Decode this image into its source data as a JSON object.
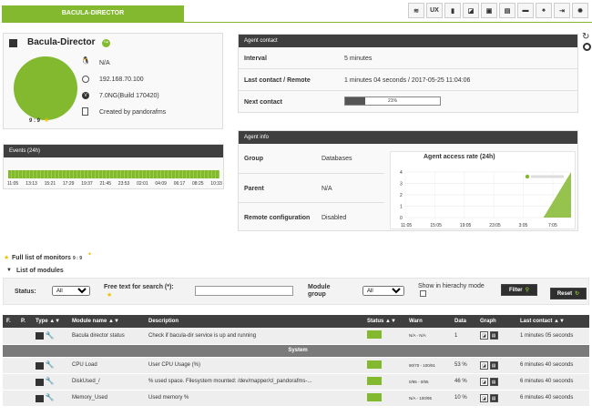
{
  "tab": {
    "label": "BACULA-DIRECTOR"
  },
  "toolbar": {
    "ux": "UX"
  },
  "agent": {
    "name": "Bacula-Director",
    "os": "N/A",
    "ip": "192.168.70.100",
    "version": "7.0NG(Build 170420)",
    "created_by": "Created by pandorafms",
    "count": "9 : 9"
  },
  "contact": {
    "title": "Agent contact",
    "rows": [
      {
        "label": "Interval",
        "value": "5 minutes"
      },
      {
        "label": "Last contact / Remote",
        "value": "1 minutes 04 seconds / 2017-05-25 11:04:06"
      },
      {
        "label": "Next contact",
        "progress": "21%",
        "progress_value": 0.21
      }
    ]
  },
  "events": {
    "title": "Events (24h)",
    "times": [
      "11:05",
      "13:13",
      "15:21",
      "17:29",
      "19:37",
      "21:45",
      "23:53",
      "02:01",
      "04:09",
      "06:17",
      "08:25",
      "10:33"
    ]
  },
  "info": {
    "title": "Agent info",
    "rows": [
      {
        "label": "Group",
        "value": "Databases"
      },
      {
        "label": "Parent",
        "value": "N/A"
      },
      {
        "label": "Remote configuration",
        "value": "Disabled"
      }
    ]
  },
  "chart_data": {
    "type": "area",
    "title": "Agent access rate (24h)",
    "x": [
      "11:05",
      "15:05",
      "19:05",
      "23:05",
      "3:05",
      "7:05"
    ],
    "y_ticks": [
      0,
      1,
      2,
      3,
      4
    ],
    "ylim": [
      0,
      4
    ],
    "series": [
      {
        "values": [
          0,
          0,
          0,
          0,
          0,
          0,
          4
        ]
      }
    ]
  },
  "monitors": {
    "full_list": "Full list of monitors",
    "count": "9 : 9",
    "list_of_modules": "List of modules",
    "status_label": "Status:",
    "status_value": "All",
    "search_label": "Free text for search (*):",
    "module_group_label": "Module group",
    "module_group_value": "All",
    "hierarchy_label": "Show in hierachy mode",
    "filter_button": "Filter",
    "reset_button": "Reset",
    "headers": [
      "F.",
      "P.",
      "Type",
      "Module name",
      "Description",
      "Status",
      "Warn",
      "Data",
      "Graph",
      "Last contact"
    ],
    "group_row": "System",
    "rows": [
      {
        "name": "Bacula director status",
        "desc": "Check if bacula-dir service is up and running",
        "warn": "N/A - N/A",
        "data": "1",
        "contact": "1 minutes 05 seconds"
      },
      {
        "name": "CPU Load",
        "desc": "User CPU Usage (%)",
        "warn": "90/70 - 100/91",
        "data": "53 %",
        "contact": "6 minutes 40 seconds"
      },
      {
        "name": "DiskUsed_/",
        "desc": "% used space. Filesystem mounted: /dev/mapper/cl_pandorafms-...",
        "warn": "0/95 - 0/95",
        "data": "46 %",
        "contact": "6 minutes 40 seconds"
      },
      {
        "name": "Memory_Used",
        "desc": "Used memory %",
        "warn": "N/A - 100/95",
        "data": "10 %",
        "contact": "6 minutes 40 seconds"
      }
    ]
  }
}
